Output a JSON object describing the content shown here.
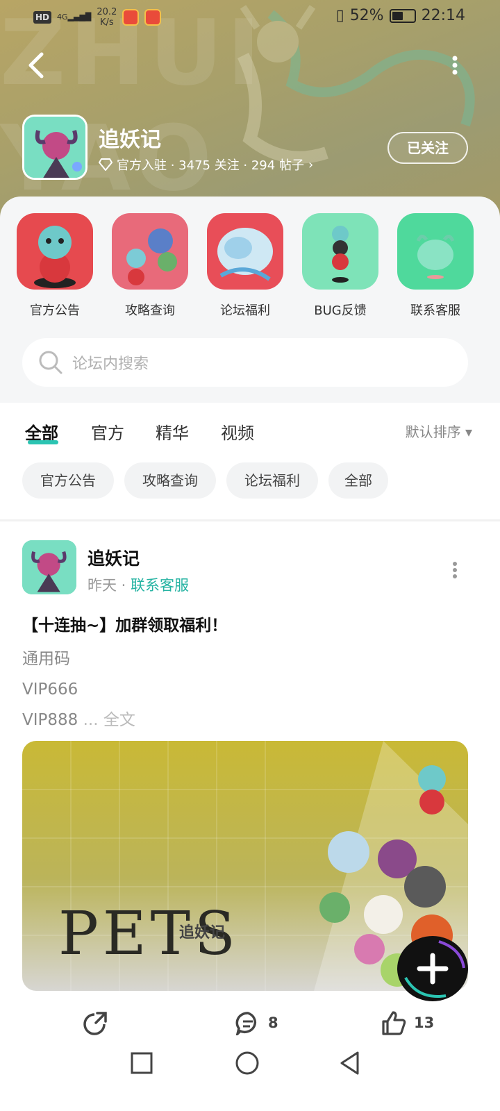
{
  "status_bar": {
    "hd": "HD",
    "signal": "4G",
    "net_speed_value": "20.2",
    "net_speed_unit": "K/s",
    "battery": "52%",
    "battery_level": 0.52,
    "time": "22:14"
  },
  "forum": {
    "name": "追妖记",
    "meta": "官方入驻 · 3475 关注 · 294 帖子",
    "follow_label": "已关注",
    "background_letters": "ZHUI YAO"
  },
  "quick_links": [
    {
      "label": "官方公告"
    },
    {
      "label": "攻略查询"
    },
    {
      "label": "论坛福利"
    },
    {
      "label": "BUG反馈"
    },
    {
      "label": "联系客服"
    }
  ],
  "search": {
    "placeholder": "论坛内搜索"
  },
  "tabs": [
    {
      "label": "全部",
      "active": true
    },
    {
      "label": "官方"
    },
    {
      "label": "精华"
    },
    {
      "label": "视频"
    }
  ],
  "sort_label": "默认排序",
  "chips": [
    {
      "label": "官方公告"
    },
    {
      "label": "攻略查询"
    },
    {
      "label": "论坛福利"
    },
    {
      "label": "全部"
    }
  ],
  "post": {
    "author": "追妖记",
    "time": "昨天",
    "category": "联系客服",
    "title": "【十连抽~】加群领取福利！",
    "lines": [
      "通用码",
      "VIP666",
      "VIP888"
    ],
    "ellipsis": " ... ",
    "more_label": "全文",
    "image": {
      "title": "PETS",
      "subtitle": "追妖记"
    },
    "comments": "8",
    "likes": "13"
  },
  "colors": {
    "accent": "#2bc4b2",
    "header_bg": "#a8a06a",
    "panel_bg": "#f5f6f7"
  }
}
